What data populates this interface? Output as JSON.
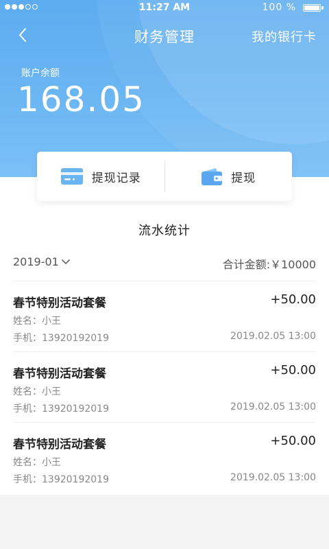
{
  "status_bar": {
    "time": "11:27 AM",
    "battery_text": "100 %",
    "battery_level": 1.0,
    "signal_filled": 3,
    "signal_total": 5
  },
  "nav": {
    "back_icon": "chevron-left-icon",
    "title": "财务管理",
    "right_link": "我的银行卡"
  },
  "balance": {
    "label": "账户余额",
    "value": "168.05"
  },
  "actions": [
    {
      "label": "提现记录",
      "icon": "card-icon"
    },
    {
      "label": "提现",
      "icon": "wallet-icon"
    }
  ],
  "statistics": {
    "title": "流水统计",
    "date_filter": "2019-01",
    "total": "合计金额:￥10000"
  },
  "transactions": [
    {
      "title": "春节特别活动套餐",
      "amount": "+50.00",
      "name": "姓名：小王",
      "phone": "手机：13920192019",
      "time": "2019.02.05 13:00"
    },
    {
      "title": "春节特别活动套餐",
      "amount": "+50.00",
      "name": "姓名：小王",
      "phone": "手机：13920192019",
      "time": "2019.02.05 13:00"
    },
    {
      "title": "春节特别活动套餐",
      "amount": "+50.00",
      "name": "姓名：小王",
      "phone": "手机：13920192019",
      "time": "2019.02.05 13:00"
    }
  ],
  "colors": {
    "accent_blue": "#5dacf0",
    "icon_blue": "#5aa7ef"
  }
}
